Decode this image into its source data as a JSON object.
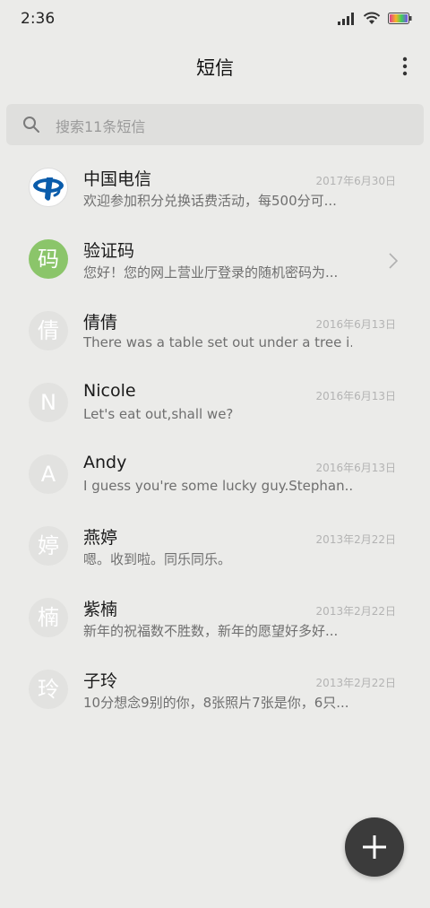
{
  "status_bar": {
    "time": "2:36"
  },
  "header": {
    "title": "短信"
  },
  "search": {
    "placeholder": "搜索11条短信"
  },
  "conversations": [
    {
      "name": "中国电信",
      "snippet": "欢迎参加积分兑换话费活动，每500分可...",
      "time": "2017年6月30日",
      "avatar_text": "",
      "avatar_type": "logo"
    },
    {
      "name": "验证码",
      "snippet": "您好！您的网上营业厅登录的随机密码为...",
      "time": "",
      "avatar_text": "码",
      "avatar_type": "green"
    },
    {
      "name": "倩倩",
      "snippet": "There was a table set out under a tree i...",
      "time": "2016年6月13日",
      "avatar_text": "倩",
      "avatar_type": "gray"
    },
    {
      "name": "Nicole",
      "snippet": "Let's eat out,shall we?",
      "time": "2016年6月13日",
      "avatar_text": "N",
      "avatar_type": "gray"
    },
    {
      "name": "Andy",
      "snippet": "I guess you're some lucky guy.Stephan...",
      "time": "2016年6月13日",
      "avatar_text": "A",
      "avatar_type": "gray"
    },
    {
      "name": "燕婷",
      "snippet": "嗯。收到啦。同乐同乐。",
      "time": "2013年2月22日",
      "avatar_text": "婷",
      "avatar_type": "gray"
    },
    {
      "name": "紫楠",
      "snippet": "新年的祝福数不胜数，新年的愿望好多好...",
      "time": "2013年2月22日",
      "avatar_text": "楠",
      "avatar_type": "gray"
    },
    {
      "name": "子玲",
      "snippet": "10分想念9别的你，8张照片7张是你，6只...",
      "time": "2013年2月22日",
      "avatar_text": "玲",
      "avatar_type": "gray"
    }
  ],
  "colors": {
    "background": "#ebebe9",
    "search_bg": "#dfdfdd",
    "avatar_green": "#8bc56a",
    "avatar_gray": "#e2e2e0",
    "fab": "#3b3b3b",
    "telecom_blue": "#0a5cab"
  },
  "icons": {
    "signal": "signal-icon",
    "wifi": "wifi-icon",
    "battery": "battery-icon",
    "more": "more-vertical-icon",
    "search": "search-icon",
    "chevron": "chevron-right-icon",
    "compose": "plus-icon"
  }
}
